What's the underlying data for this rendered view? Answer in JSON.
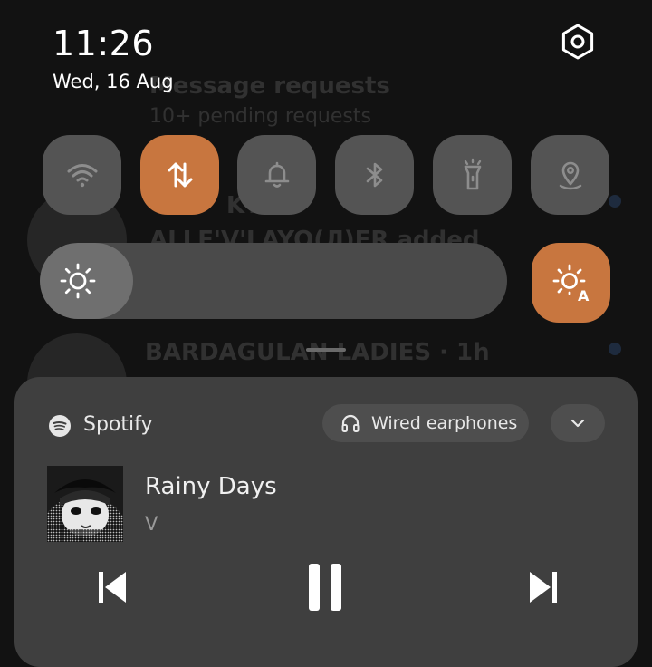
{
  "status": {
    "time": "11:26",
    "date": "Wed, 16 Aug"
  },
  "background_app": {
    "row1_title": "Message requests",
    "row1_subtitle": "10+ pending requests",
    "row2_title": "KTI",
    "row2_subtitle": "ALLE'V'LAYO(Л)ER added",
    "row3_title": "BARDAGULAN LADIES · 1h"
  },
  "quick_settings": {
    "tiles": [
      {
        "name": "wifi",
        "icon": "wifi-icon",
        "active": false
      },
      {
        "name": "mobile-data",
        "icon": "data-transfer-icon",
        "active": true
      },
      {
        "name": "sound",
        "icon": "bell-icon",
        "active": false
      },
      {
        "name": "bluetooth",
        "icon": "bluetooth-icon",
        "active": false
      },
      {
        "name": "flashlight",
        "icon": "flashlight-icon",
        "active": false
      },
      {
        "name": "location",
        "icon": "location-pin-icon",
        "active": false
      }
    ],
    "brightness_level": 0.2,
    "auto_brightness_label": "A",
    "accent_color": "#c8763f"
  },
  "media": {
    "app_name": "Spotify",
    "output_device": "Wired earphones",
    "track_title": "Rainy Days",
    "artist": "V",
    "state": "playing"
  }
}
